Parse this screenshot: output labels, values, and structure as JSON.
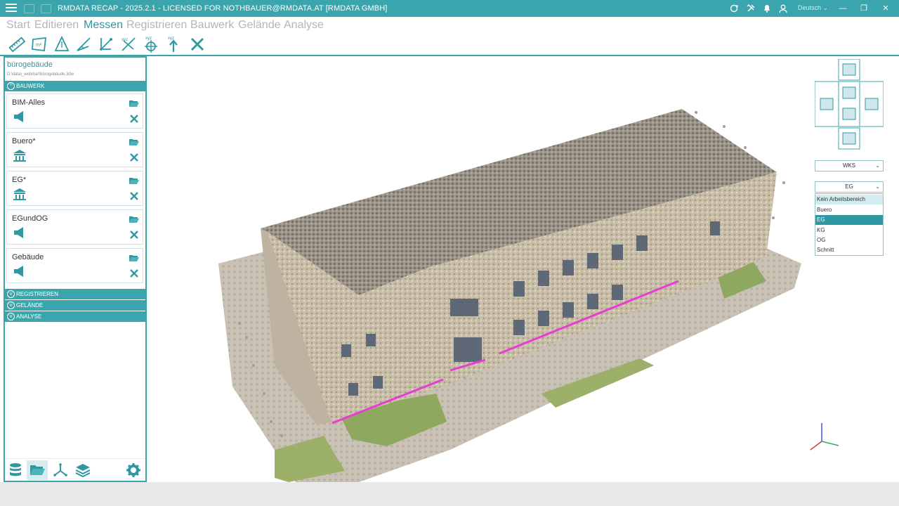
{
  "titlebar": {
    "title": "RMDATA RECAP - 2025.2.1 - LICENSED FOR NOTHBAUER@RMDATA.AT [RMDATA GMBH]",
    "language": "Deutsch",
    "language_arrow": "⌄",
    "win_minimize": "—",
    "win_restore": "❐",
    "win_close": "✕"
  },
  "ribbon_tabs": [
    "Start",
    "Editieren",
    "Messen",
    "Registrieren",
    "Bauwerk",
    "Gelände",
    "Analyse"
  ],
  "active_tab": "Messen",
  "toolbar": {
    "tools": [
      "ruler-icon",
      "area-m2-icon",
      "height-triangle-icon",
      "angle-icon",
      "coordinate-measure-icon",
      "slope-icon",
      "xyz-point-icon",
      "xyz-height-icon",
      "close-icon"
    ],
    "area_label": "m²",
    "xyz_label": "xyz"
  },
  "project": {
    "name": "bürogebäude",
    "path": "D:\\data\\_webinar\\bürogebäude.3dw"
  },
  "sections": {
    "bauwerk": "BAUWERK",
    "registrieren": "REGISTRIEREN",
    "gelaende": "GELÄNDE",
    "analyse": "ANALYSE",
    "expanded_chevron": "^",
    "collapsed_chevron": "v"
  },
  "workspaces": [
    {
      "name": "BIM-Alles",
      "icon": "megaphone-icon"
    },
    {
      "name": "Buero*",
      "icon": "building-icon"
    },
    {
      "name": "EG*",
      "icon": "building-icon"
    },
    {
      "name": "EGundOG",
      "icon": "megaphone-icon"
    },
    {
      "name": "Gebäude",
      "icon": "megaphone-icon"
    }
  ],
  "bottom_nav": [
    "database-icon",
    "folder-open-icon",
    "axes-icon",
    "layers-icon",
    "gear-icon"
  ],
  "view": {
    "coord_system": "WKS",
    "workspace_selected": "EG",
    "dropdown_arrow": "⌄",
    "workspace_options": [
      "Kein Arbeitsbereich",
      "Buero",
      "EG",
      "KG",
      "OG",
      "Schnitt"
    ]
  },
  "colors": {
    "accent": "#3aa5ad",
    "accent_dark": "#2f98a2",
    "measure_line": "#e83cd4",
    "inactive_tab": "#b5b5b5"
  }
}
